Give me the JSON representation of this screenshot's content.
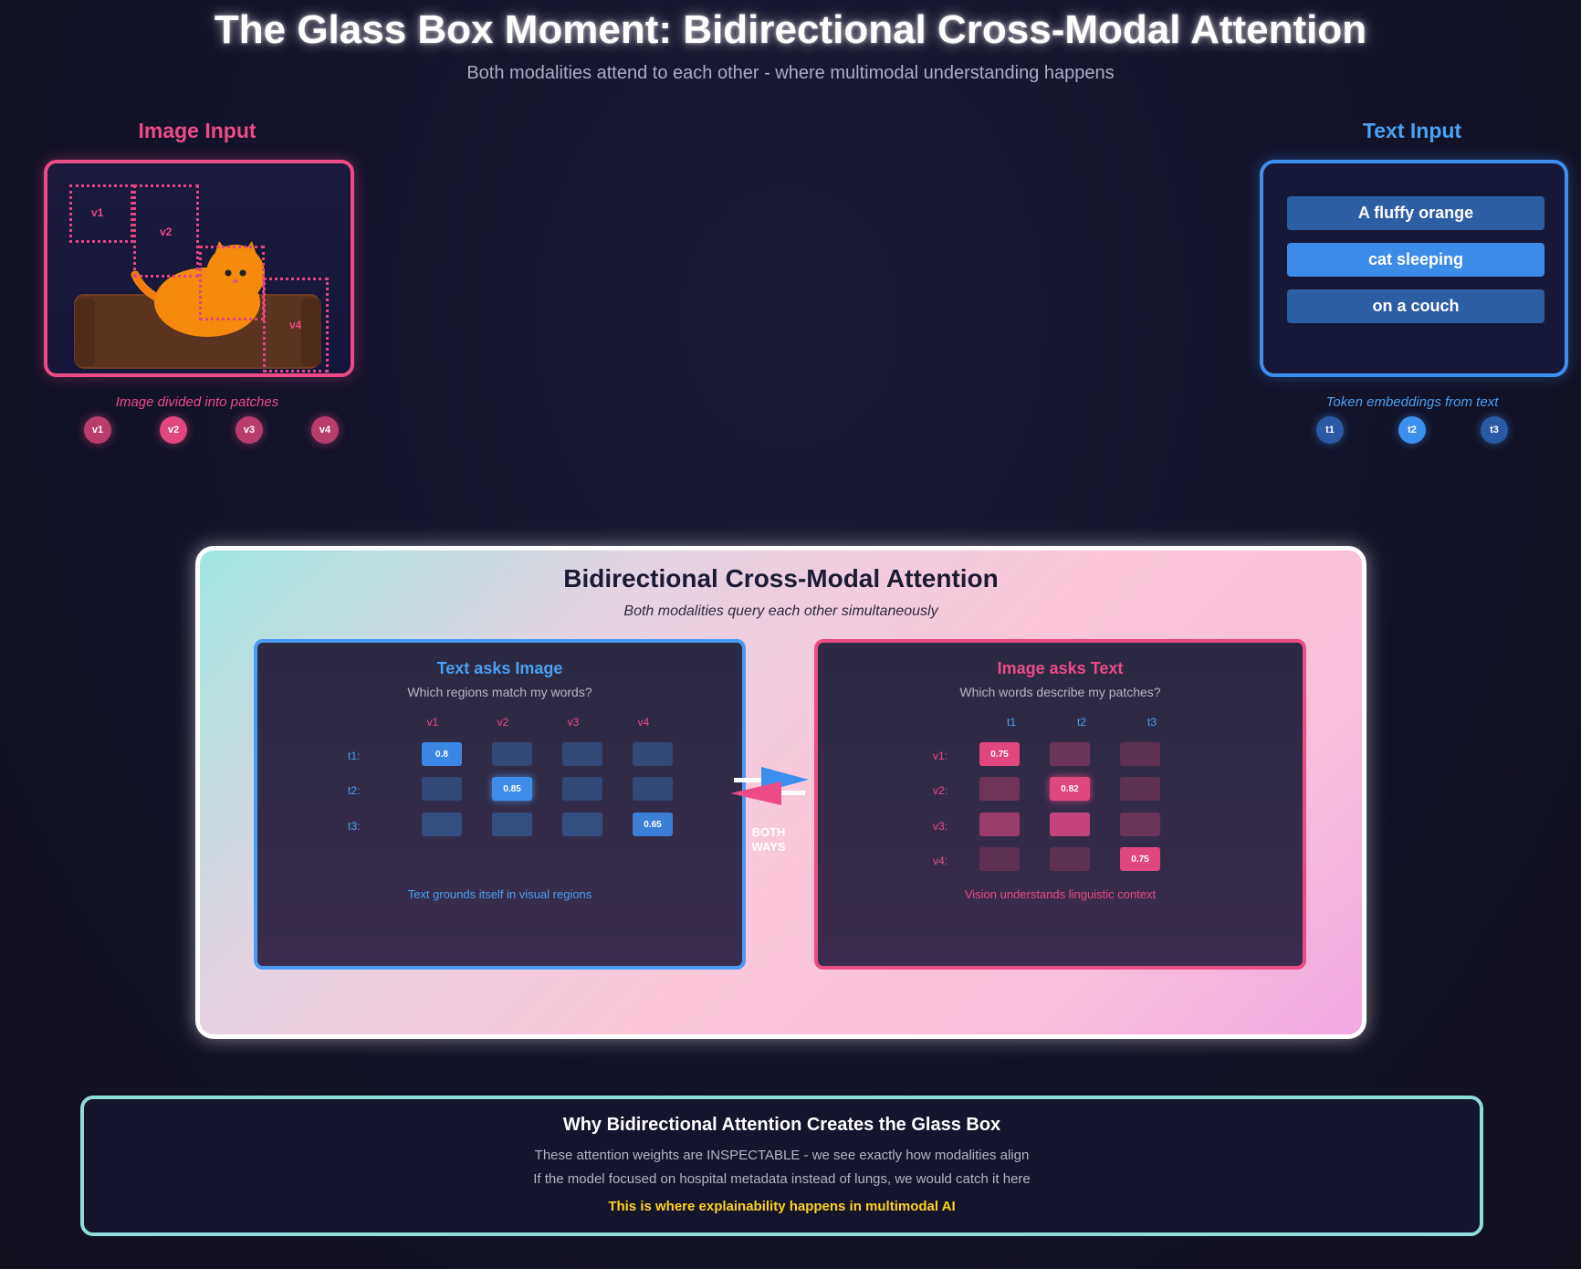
{
  "header": {
    "title": "The Glass Box Moment: Bidirectional Cross-Modal Attention",
    "subtitle": "Both modalities attend to each other - where multimodal understanding happens"
  },
  "image_input": {
    "title": "Image Input",
    "patch_labels": [
      "v1",
      "v2",
      "v4"
    ],
    "caption": "Image divided into patches",
    "tokens": [
      "v1",
      "v2",
      "v3",
      "v4"
    ]
  },
  "text_input": {
    "title": "Text Input",
    "phrases": [
      "A fluffy orange",
      "cat sleeping",
      "on a couch"
    ],
    "caption": "Token embeddings from text",
    "tokens": [
      "t1",
      "t2",
      "t3"
    ]
  },
  "attention": {
    "title": "Bidirectional Cross-Modal Attention",
    "subtitle": "Both modalities query each other simultaneously",
    "connector_label": "BOTH WAYS",
    "text_to_image": {
      "title": "Text asks Image",
      "question": "Which regions match my words?",
      "columns": [
        "v1",
        "v2",
        "v3",
        "v4"
      ],
      "rows": [
        "t1:",
        "t2:",
        "t3:"
      ],
      "values": [
        [
          "0.8",
          "",
          "",
          ""
        ],
        [
          "",
          "0.85",
          "",
          ""
        ],
        [
          "",
          "",
          "",
          "0.65"
        ]
      ],
      "footer": "Text grounds itself in visual regions"
    },
    "image_to_text": {
      "title": "Image asks Text",
      "question": "Which words describe my patches?",
      "columns": [
        "t1",
        "t2",
        "t3"
      ],
      "rows": [
        "v1:",
        "v2:",
        "v3:",
        "v4:"
      ],
      "values": [
        [
          "0.75",
          "",
          ""
        ],
        [
          "",
          "0.82",
          ""
        ],
        [
          "",
          "",
          ""
        ],
        [
          "",
          "",
          "0.75"
        ]
      ],
      "footer": "Vision understands linguistic context"
    }
  },
  "why": {
    "title": "Why Bidirectional Attention Creates the Glass Box",
    "line1": "These attention weights are INSPECTABLE - we see exactly how modalities align",
    "line2": "If the model focused on hospital metadata instead of lungs, we would catch it here",
    "highlight": "This is where explainability happens in multimodal AI"
  },
  "colors": {
    "image_accent": "#ec4b86",
    "text_accent": "#4aa0f2",
    "highlight": "#ffd21f"
  }
}
